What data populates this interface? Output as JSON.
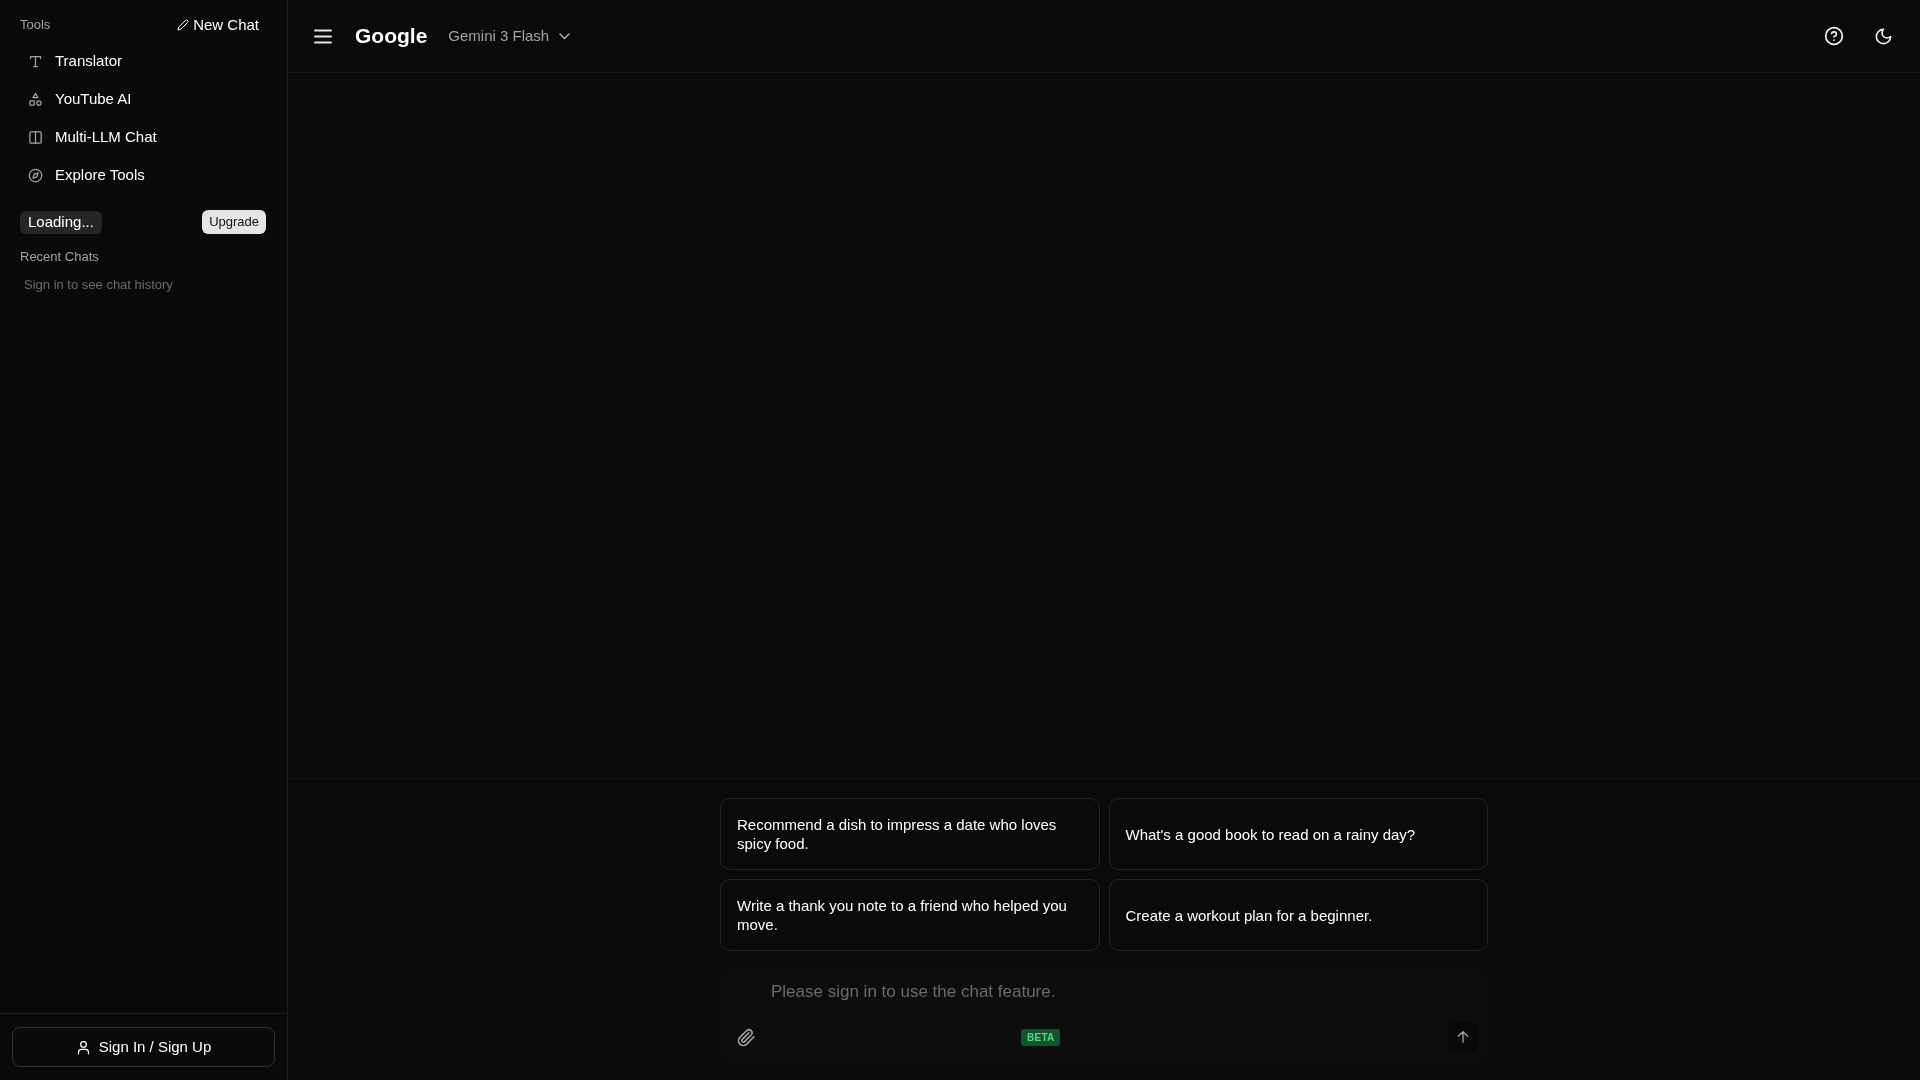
{
  "sidebar": {
    "section_label": "Tools",
    "new_chat_button": "New Chat",
    "tools": [
      {
        "label": "Translator"
      },
      {
        "label": "YouTube AI"
      },
      {
        "label": "Multi-LLM Chat"
      },
      {
        "label": "Explore Tools"
      }
    ],
    "plan_badge": "Loading...",
    "upgrade_button": "Upgrade",
    "recent_chats": {
      "title": "Recent Chats",
      "empty_message": "Sign in to see chat history"
    },
    "sign_in_button": "Sign In / Sign Up"
  },
  "header": {
    "brand": "Google",
    "model_selector": "Gemini 3 Flash"
  },
  "suggestions": [
    "Recommend a dish to impress a date who loves spicy food.",
    "What's a good book to read on a rainy day?",
    "Write a thank you note to a friend who helped you move.",
    "Create a workout plan for a beginner."
  ],
  "composer": {
    "placeholder": "Please sign in to use the chat feature.",
    "badge": "BETA"
  }
}
